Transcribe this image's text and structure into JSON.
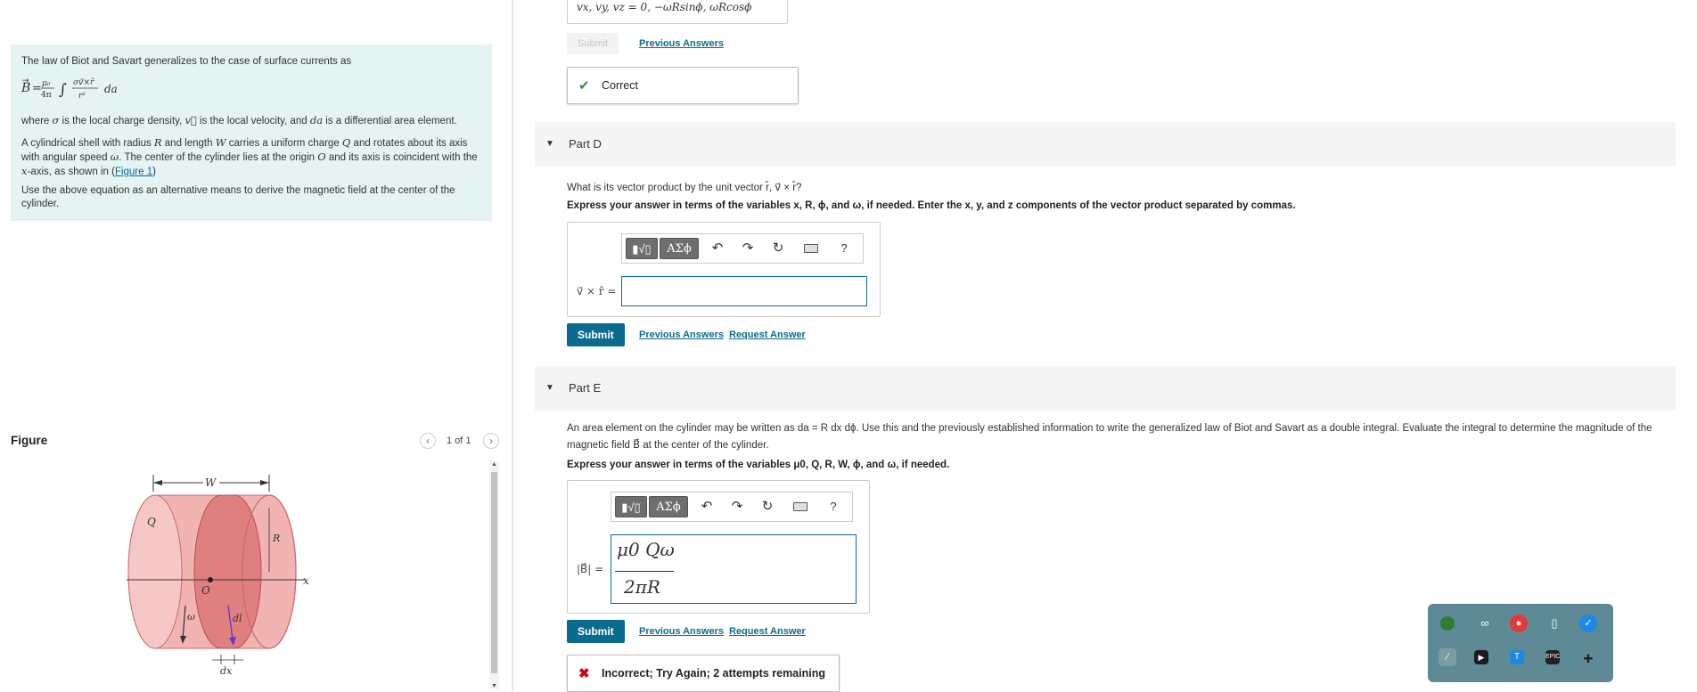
{
  "intro": {
    "line1": "The law of Biot and Savart generalizes to the case of surface currents as",
    "line2_pre": "where ",
    "line2_sigma": "σ",
    "line2_a": " is the local charge density, ",
    "line2_v": "v⃗",
    "line2_b": " is the local velocity, and ",
    "line2_da": "da",
    "line2_c": " is a differential area element.",
    "p3a": "A cylindrical shell with radius ",
    "p3_R": "R",
    "p3b": " and length ",
    "p3_W": "W",
    "p3c": " carries a uniform charge ",
    "p3_Q": "Q",
    "p3d": " and rotates about its axis with angular speed ",
    "p3_w": "ω",
    "p3e": ". The center of the cylinder lies at the origin ",
    "p3_O": "O",
    "p3f": " and its axis is coincident with the ",
    "p3_x": "x",
    "p3g": "-axis, as shown in (",
    "p3_link": "Figure 1",
    "p3h": ")",
    "p4": "Use the above equation as an alternative means to derive the magnetic field at the center of the cylinder."
  },
  "figure": {
    "title": "Figure",
    "count": "1 of 1",
    "labels": {
      "W": "W",
      "Q": "Q",
      "R": "R",
      "O": "O",
      "x": "x",
      "omega": "ω",
      "dl": "dl",
      "dx": "dx"
    }
  },
  "colors": {
    "accent": "#0b6b8f",
    "intro_bg": "#e5f3f3",
    "correct": "#2e8b3e",
    "incorrect": "#d0021b",
    "cylinder": "#f2b3b3"
  },
  "partC": {
    "answer_text": "vx, vy, vz = 0, −ωRsinϕ, ωRcosϕ",
    "submit": "Submit",
    "prev": "Previous Answers",
    "feedback": "Correct"
  },
  "partD": {
    "label": "Part D",
    "question": "What is its vector product by the unit vector r̂, v⃗ × r̂?",
    "instr": "Express your answer in terms of the variables x, R, ϕ, and ω, if needed. Enter the x, y, and z components of the vector product separated by commas.",
    "field_label": "v⃗ × r̂ =",
    "greek": "ΑΣϕ",
    "help": "?",
    "submit": "Submit",
    "prev": "Previous Answers",
    "request": "Request Answer"
  },
  "partE": {
    "label": "Part E",
    "question": "An area element on the cylinder may be written as da = R dx dϕ. Use this and the previously established information to write the generalized law of Biot and Savart as a double integral. Evaluate the integral to determine the magnitude of the magnetic field B⃗ at the center of the cylinder.",
    "instr": "Express your answer in terms of the variables μ0, Q, R, W, ϕ, and ω, if needed.",
    "field_label": "|B⃗| =",
    "numerator": "μ0 Qω",
    "denominator": "2πR",
    "greek": "ΑΣϕ",
    "help": "?",
    "submit": "Submit",
    "prev": "Previous Answers",
    "request": "Request Answer",
    "feedback": "Incorrect; Try Again; 2 attempts remaining"
  }
}
